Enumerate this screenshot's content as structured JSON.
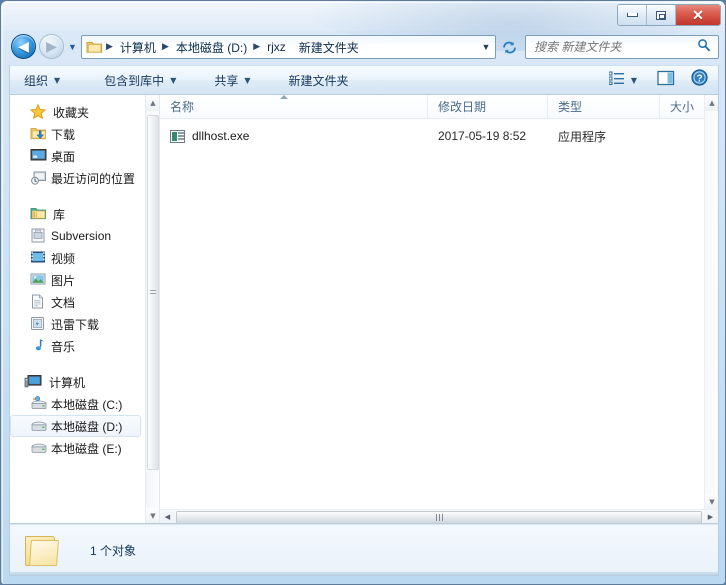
{
  "window": {
    "controls": {
      "minimize_label": "最小化",
      "maximize_label": "最大化",
      "close_label": "✕"
    }
  },
  "navigation": {
    "back_label": "◀",
    "forward_label": "▶",
    "back_tooltip": "后退",
    "forward_tooltip": "前进",
    "history_caret": "▼",
    "address_caret": "▼",
    "breadcrumbs": [
      {
        "label": "计算机",
        "sep": "▶"
      },
      {
        "label": "本地磁盘 (D:)",
        "sep": "▶"
      },
      {
        "label": "rjxz",
        "sep": "▶"
      },
      {
        "label": "新建文件夹",
        "sep": ""
      }
    ]
  },
  "search": {
    "value": "",
    "placeholder": "搜索 新建文件夹",
    "icon": "search-icon"
  },
  "command_bar": {
    "items": [
      {
        "label": "组织",
        "caret": "▼"
      },
      {
        "label": "包含到库中",
        "caret": "▼"
      },
      {
        "label": "共享",
        "caret": "▼"
      },
      {
        "label": "新建文件夹",
        "caret": ""
      }
    ],
    "view_caret": "▼",
    "view_icon": "list-view-icon",
    "preview_pane_icon": "preview-pane-icon",
    "help_icon": "help-icon"
  },
  "sidebar": {
    "groups": [
      {
        "header": {
          "label": "收藏夹",
          "icon": "star-icon"
        },
        "items": [
          {
            "label": "下载",
            "icon": "download-folder-icon"
          },
          {
            "label": "桌面",
            "icon": "desktop-icon"
          },
          {
            "label": "最近访问的位置",
            "icon": "recent-places-icon"
          }
        ]
      },
      {
        "header": {
          "label": "库",
          "icon": "library-icon"
        },
        "items": [
          {
            "label": "Subversion",
            "icon": "subversion-icon"
          },
          {
            "label": "视频",
            "icon": "video-icon"
          },
          {
            "label": "图片",
            "icon": "pictures-icon"
          },
          {
            "label": "文档",
            "icon": "documents-icon"
          },
          {
            "label": "迅雷下载",
            "icon": "thunder-download-icon"
          },
          {
            "label": "音乐",
            "icon": "music-icon"
          }
        ]
      },
      {
        "header": {
          "label": "计算机",
          "icon": "computer-icon"
        },
        "items": [
          {
            "label": "本地磁盘 (C:)",
            "icon": "system-drive-icon",
            "selected": false
          },
          {
            "label": "本地磁盘 (D:)",
            "icon": "drive-icon",
            "selected": true
          },
          {
            "label": "本地磁盘 (E:)",
            "icon": "drive-icon",
            "selected": false
          }
        ]
      }
    ],
    "scrollbar": {
      "up": "▲",
      "down": "▼"
    }
  },
  "file_list": {
    "columns": [
      {
        "key": "name",
        "label": "名称",
        "sorted": "ascending"
      },
      {
        "key": "date",
        "label": "修改日期",
        "sorted": ""
      },
      {
        "key": "type",
        "label": "类型",
        "sorted": ""
      },
      {
        "key": "size",
        "label": "大小",
        "sorted": ""
      }
    ],
    "rows": [
      {
        "name": "dllhost.exe",
        "date": "2017-05-19 8:52",
        "type": "应用程序",
        "size": "",
        "icon": "executable-icon"
      }
    ],
    "vscroll": {
      "up": "▲",
      "down": "▼"
    },
    "hscroll": {
      "left": "◀",
      "right": "▶"
    }
  },
  "status_bar": {
    "text": "1 个对象",
    "icon": "folder-icon"
  },
  "colors": {
    "accent": "#1c5fa8",
    "glass": "#cfe2f5",
    "close_button": "#c0372b",
    "column_header_text": "#4a6c8c"
  }
}
